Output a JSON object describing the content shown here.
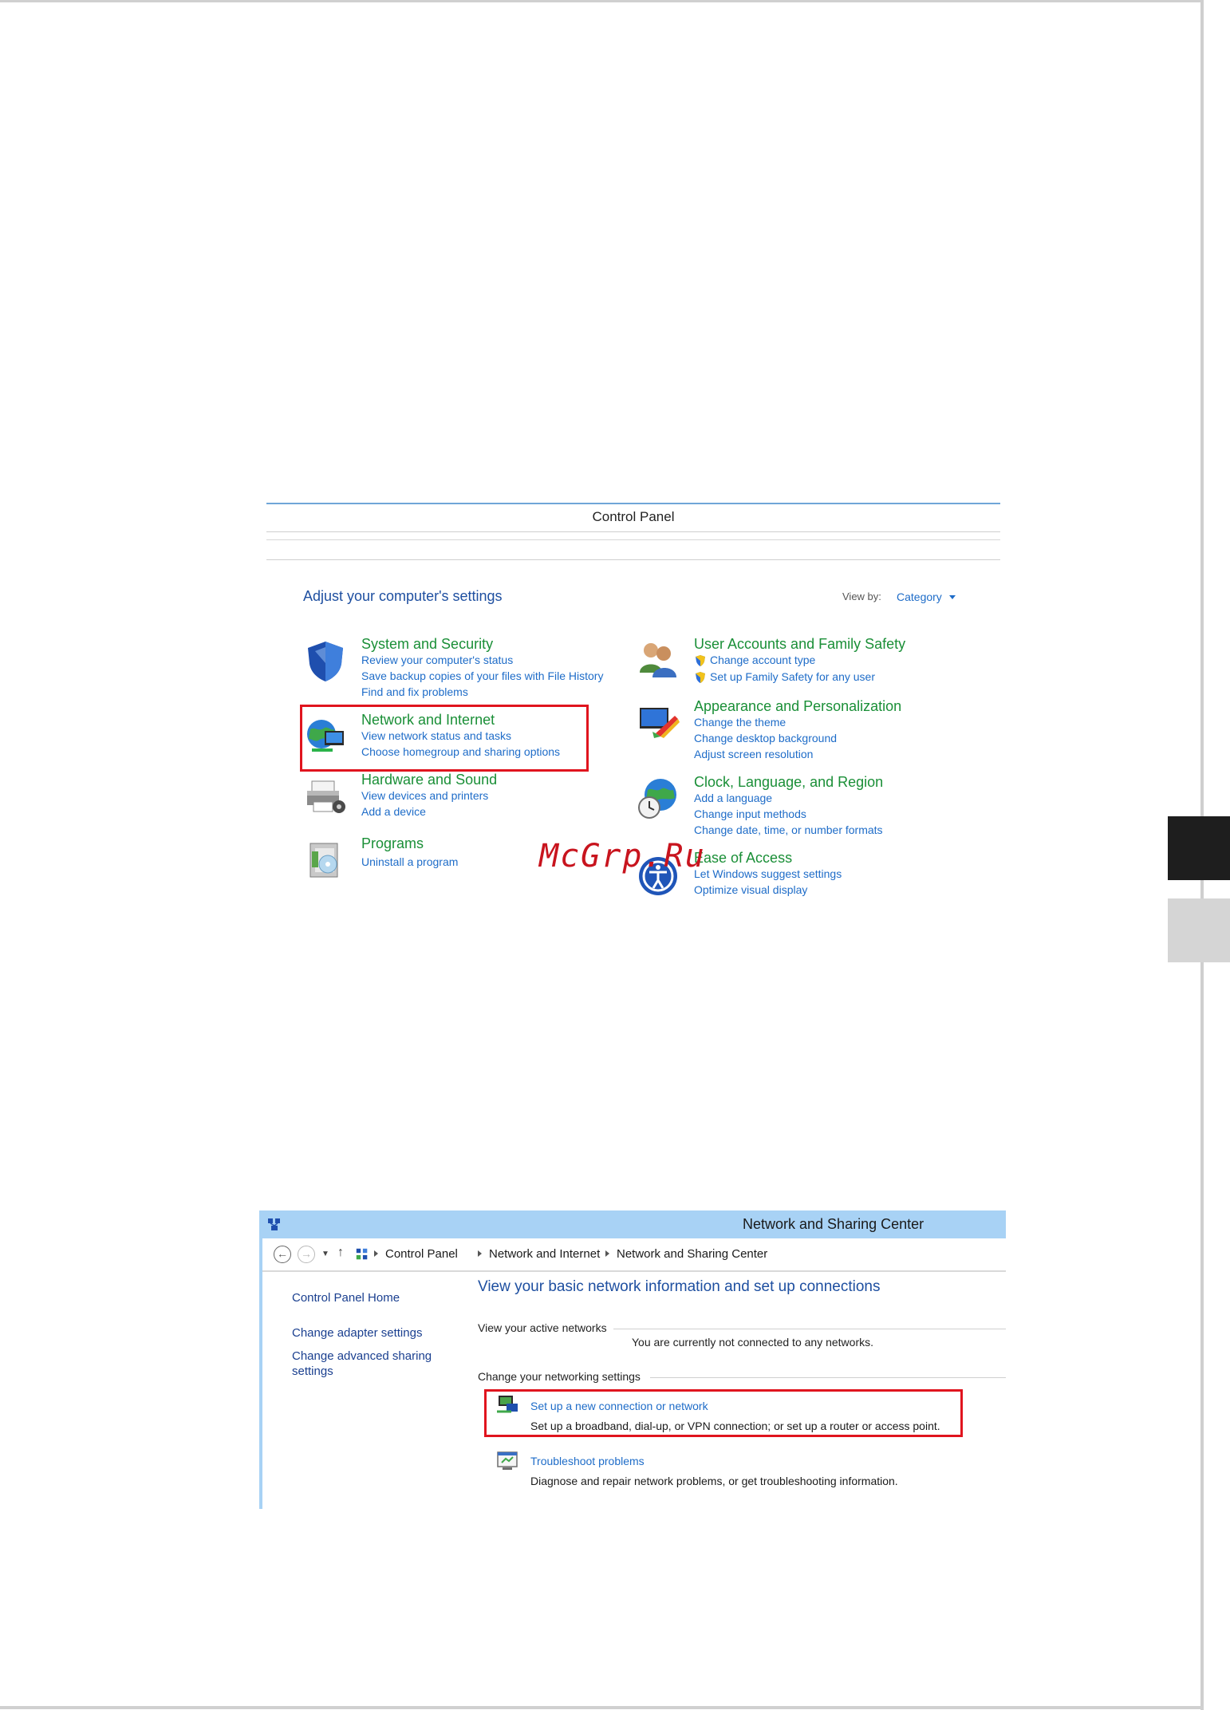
{
  "control_panel": {
    "window_title": "Control Panel",
    "heading": "Adjust your computer's settings",
    "view_by_label": "View by:",
    "view_by_value": "Category",
    "left_categories": [
      {
        "title": "System and Security",
        "links": [
          "Review your computer's status",
          "Save backup copies of your files with File History",
          "Find and fix problems"
        ],
        "icon": "shield-icon"
      },
      {
        "title": "Network and Internet",
        "links": [
          "View network status and tasks",
          "Choose homegroup and sharing options"
        ],
        "icon": "network-globe-icon"
      },
      {
        "title": "Hardware and Sound",
        "links": [
          "View devices and printers",
          "Add a device"
        ],
        "icon": "printer-icon"
      },
      {
        "title": "Programs",
        "links": [
          "Uninstall a program"
        ],
        "icon": "programs-icon"
      }
    ],
    "right_categories": [
      {
        "title": "User Accounts and Family Safety",
        "links": [
          "Change account type",
          "Set up Family Safety for any user"
        ],
        "icon": "users-icon"
      },
      {
        "title": "Appearance and Personalization",
        "links": [
          "Change the theme",
          "Change desktop background",
          "Adjust screen resolution"
        ],
        "icon": "monitor-paint-icon"
      },
      {
        "title": "Clock, Language, and Region",
        "links": [
          "Add a language",
          "Change input methods",
          "Change date, time, or number formats"
        ],
        "icon": "globe-clock-icon"
      },
      {
        "title": "Ease of Access",
        "links": [
          "Let Windows suggest settings",
          "Optimize visual display"
        ],
        "icon": "ease-of-access-icon"
      }
    ]
  },
  "watermark": "McGrp.Ru",
  "network_center": {
    "window_title": "Network and Sharing Center",
    "breadcrumb": [
      "Control Panel",
      "Network and Internet",
      "Network and Sharing Center"
    ],
    "left_nav": {
      "home": "Control Panel Home",
      "adapter": "Change adapter settings",
      "advanced_line1": "Change advanced sharing",
      "advanced_line2": "settings"
    },
    "main_heading": "View your basic network information and set up connections",
    "active_networks_label": "View your active networks",
    "not_connected": "You are currently not connected to any networks.",
    "change_settings_label": "Change your networking settings",
    "tasks": [
      {
        "link": "Set up a new connection or network",
        "desc": "Set up a broadband, dial-up, or VPN connection; or set up a router or access point.",
        "icon": "network-setup-icon"
      },
      {
        "link": "Troubleshoot problems",
        "desc": "Diagnose and repair network problems, or get troubleshooting information.",
        "icon": "troubleshoot-icon"
      }
    ]
  },
  "colors": {
    "green_title": "#1a8f37",
    "link_blue": "#1e6cc8",
    "heading_blue": "#1e4fa0",
    "highlight_red": "#e0141e",
    "titlebar_blue": "#a8d2f5"
  }
}
